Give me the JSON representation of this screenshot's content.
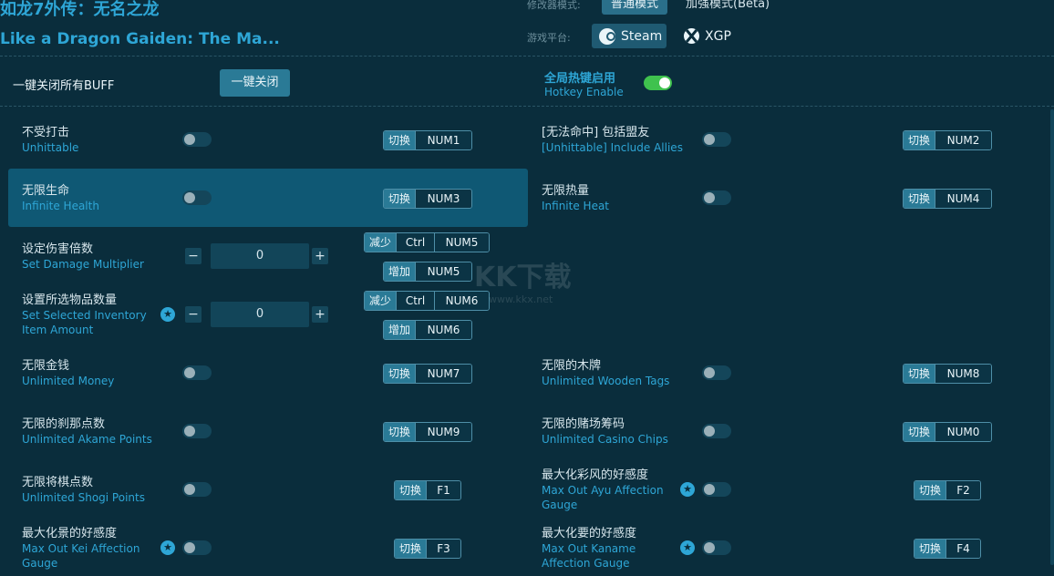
{
  "header": {
    "title_cn": "如龙7外传：无名之龙",
    "title_en": "Like a Dragon Gaiden: The Ma...",
    "mode_label": "修改器模式:",
    "mode_normal": "普通模式",
    "mode_enhanced": "加强模式(Beta)",
    "platform_label": "游戏平台:",
    "platform_steam": "Steam",
    "platform_xgp": "XGP"
  },
  "topbar": {
    "close_all_label": "一键关闭所有BUFF",
    "close_all_button": "一键关闭",
    "hotkey_cn": "全局热键启用",
    "hotkey_en": "Hotkey Enable",
    "hotkey_enabled": true
  },
  "labels": {
    "switch": "切换",
    "decrease": "减少",
    "increase": "增加",
    "minus": "−",
    "plus": "+",
    "star": "★"
  },
  "cheats": [
    {
      "cn": "不受打击",
      "en": "Unhittable",
      "key": "NUM1",
      "on": false
    },
    {
      "cn": "[无法命中] 包括盟友",
      "en": "[Unhittable] Include Allies",
      "key": "NUM2",
      "on": false
    },
    {
      "cn": "无限生命",
      "en": "Infinite Health",
      "key": "NUM3",
      "on": false
    },
    {
      "cn": "无限热量",
      "en": "Infinite Heat",
      "key": "NUM4",
      "on": false
    },
    {
      "cn": "设定伤害倍数",
      "en": "Set Damage Multiplier",
      "value": "0",
      "dec_keys": [
        "Ctrl",
        "NUM5"
      ],
      "inc_keys": [
        "NUM5"
      ]
    },
    {
      "cn": "设置所选物品数量",
      "en_line1": "Set Selected Inventory",
      "en_line2": "Item Amount",
      "value": "0",
      "dec_keys": [
        "Ctrl",
        "NUM6"
      ],
      "inc_keys": [
        "NUM6"
      ]
    },
    {
      "cn": "无限金钱",
      "en": "Unlimited Money",
      "key": "NUM7",
      "on": false
    },
    {
      "cn": "无限的木牌",
      "en": "Unlimited Wooden Tags",
      "key": "NUM8",
      "on": false
    },
    {
      "cn": "无限的刹那点数",
      "en": "Unlimited Akame Points",
      "key": "NUM9",
      "on": false
    },
    {
      "cn": "无限的赌场筹码",
      "en": "Unlimited Casino Chips",
      "key": "NUM0",
      "on": false
    },
    {
      "cn": "无限将棋点数",
      "en": "Unlimited Shogi Points",
      "key": "F1",
      "on": false
    },
    {
      "cn": "最大化彩风的好感度",
      "en_line1": "Max Out Ayu Affection",
      "en_line2": "Gauge",
      "key": "F2",
      "on": false
    },
    {
      "cn": "最大化景的好感度",
      "en_line1": "Max Out Kei Affection",
      "en_line2": "Gauge",
      "key": "F3",
      "on": false
    },
    {
      "cn": "最大化要的好感度",
      "en_line1": "Max Out Kaname",
      "en_line2": "Affection Gauge",
      "key": "F4",
      "on": false
    }
  ],
  "watermark": {
    "big": "KK下载",
    "small": "www.kkx.net"
  },
  "colors": {
    "accent": "#2ea6d6",
    "background": "#0a2d3c",
    "toggle_on": "#3fc24e"
  }
}
